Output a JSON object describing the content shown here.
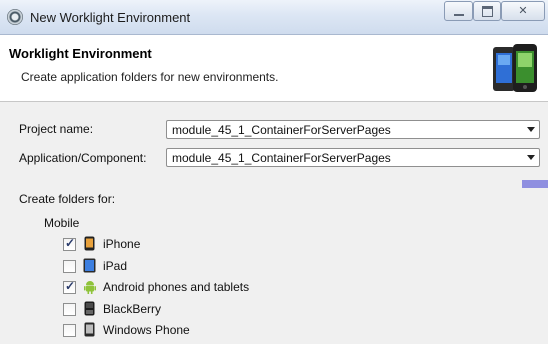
{
  "window": {
    "title": "New Worklight Environment"
  },
  "banner": {
    "title": "Worklight Environment",
    "subtitle": "Create application folders for new environments."
  },
  "form": {
    "project_label": "Project name:",
    "project_value": "module_45_1_ContainerForServerPages",
    "app_label": "Application/Component:",
    "app_value": "module_45_1_ContainerForServerPages"
  },
  "folders": {
    "heading": "Create folders for:",
    "group": "Mobile",
    "items": [
      {
        "label": "iPhone",
        "checked": true
      },
      {
        "label": "iPad",
        "checked": false
      },
      {
        "label": "Android phones and tablets",
        "checked": true
      },
      {
        "label": "BlackBerry",
        "checked": false
      },
      {
        "label": "Windows Phone",
        "checked": false
      }
    ]
  }
}
